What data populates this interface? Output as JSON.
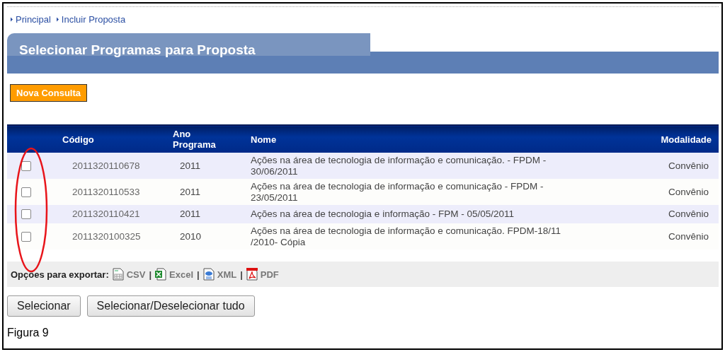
{
  "breadcrumb": [
    {
      "label": "Principal"
    },
    {
      "label": "Incluir Proposta"
    }
  ],
  "title": "Selecionar Programas para Proposta",
  "new_query_button": "Nova Consulta",
  "table": {
    "columns": [
      "Código",
      "Ano Programa",
      "Nome",
      "Modalidade"
    ],
    "rows": [
      {
        "checked": false,
        "codigo": "2011320110678",
        "ano": "2011",
        "nome": "Ações na área de tecnologia de informação e comunicação. - FPDM - 30/06/2011",
        "modalidade": "Convênio"
      },
      {
        "checked": false,
        "codigo": "2011320110533",
        "ano": "2011",
        "nome": "Ações na área de tecnologia de informação e comunicação - FPDM - 23/05/2011",
        "modalidade": "Convênio"
      },
      {
        "checked": false,
        "codigo": "2011320110421",
        "ano": "2011",
        "nome": "Ações na área de tecnologia e informação - FPM - 05/05/2011",
        "modalidade": "Convênio"
      },
      {
        "checked": false,
        "codigo": "2011320100325",
        "ano": "2010",
        "nome": "Ações na área de tecnologia de informação e comunicação. FPDM-18/11 /2010- Cópia",
        "modalidade": "Convênio"
      }
    ]
  },
  "export": {
    "label": "Opções para exportar:",
    "separator": "|",
    "items": [
      {
        "kind": "csv",
        "label": "CSV"
      },
      {
        "kind": "excel",
        "label": "Excel"
      },
      {
        "kind": "xml",
        "label": "XML"
      },
      {
        "kind": "pdf",
        "label": "PDF"
      }
    ]
  },
  "buttons": [
    "Selecionar",
    "Selecionar/Deselecionar tudo"
  ],
  "caption": "Figura 9"
}
